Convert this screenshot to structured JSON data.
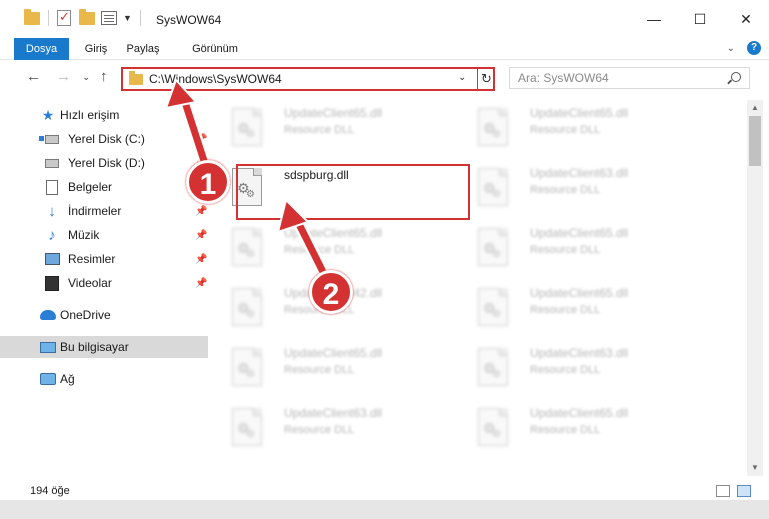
{
  "window": {
    "title": "SysWOW64",
    "minimize": "—",
    "maximize": "☐",
    "close": "✕"
  },
  "ribbon": {
    "tabs": [
      "Dosya",
      "Giriş",
      "Paylaş",
      "Görünüm"
    ],
    "help": "?"
  },
  "address": {
    "path": "C:\\Windows\\SysWOW64",
    "dropdown": "⌄",
    "refresh": "↻"
  },
  "search": {
    "placeholder": "Ara: SysWOW64"
  },
  "nav": {
    "back": "←",
    "forward": "→",
    "recent": "⌄",
    "up": "↑"
  },
  "sidebar": {
    "items": [
      {
        "label": "Hızlı erişim",
        "icon": "star-icon"
      },
      {
        "label": "Yerel Disk (C:)",
        "icon": "drive-icon"
      },
      {
        "label": "Yerel Disk (D:)",
        "icon": "drive-icon"
      },
      {
        "label": "Belgeler",
        "icon": "document-icon"
      },
      {
        "label": "İndirmeler",
        "icon": "download-icon"
      },
      {
        "label": "Müzik",
        "icon": "music-icon"
      },
      {
        "label": "Resimler",
        "icon": "pictures-icon"
      },
      {
        "label": "Videolar",
        "icon": "videos-icon"
      },
      {
        "label": "OneDrive",
        "icon": "cloud-icon"
      },
      {
        "label": "Bu bilgisayar",
        "icon": "computer-icon"
      },
      {
        "label": "Ağ",
        "icon": "network-icon"
      }
    ],
    "pinned_indices": [
      1,
      2,
      3,
      4,
      5,
      6,
      7
    ]
  },
  "files": {
    "left_column": [
      {
        "name": "UpdateClient65.dll",
        "type": "Resource DLL"
      },
      {
        "name": "sdspburg.dll",
        "type": ""
      },
      {
        "name": "UpdateClient65.dll",
        "type": "Resource DLL"
      },
      {
        "name": "UpdateClient42.dll",
        "type": "Resource DLL"
      },
      {
        "name": "UpdateClient65.dll",
        "type": "Resource DLL"
      },
      {
        "name": "UpdateClient63.dll",
        "type": "Resource DLL"
      }
    ],
    "right_column": [
      {
        "name": "UpdateClient65.dll",
        "type": "Resource DLL"
      },
      {
        "name": "UpdateClient63.dll",
        "type": "Resource DLL"
      },
      {
        "name": "UpdateClient65.dll",
        "type": "Resource DLL"
      },
      {
        "name": "UpdateClient65.dll",
        "type": "Resource DLL"
      },
      {
        "name": "UpdateClient63.dll",
        "type": "Resource DLL"
      },
      {
        "name": "UpdateClient65.dll",
        "type": "Resource DLL"
      }
    ]
  },
  "status": {
    "count": "194 öğe"
  },
  "annotations": {
    "badge1": "1",
    "badge2": "2",
    "accent": "#d43232"
  },
  "colors": {
    "file_tab": "#1979ca",
    "selected_sidebar": "#d9d9d9",
    "highlight": "#d43232"
  }
}
